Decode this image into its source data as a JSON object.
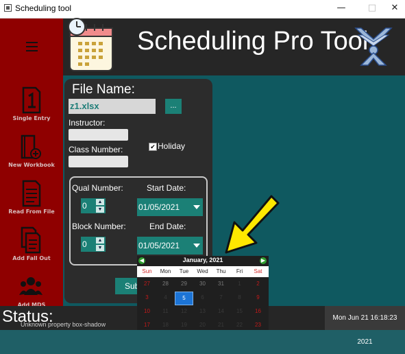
{
  "window": {
    "title": "Scheduling tool",
    "controls": [
      "—",
      "□",
      "✕"
    ]
  },
  "header": {
    "title": "Scheduling Pro Tool"
  },
  "sidebar": {
    "items": [
      {
        "label": "Single Entry",
        "icon": "number-one-document-icon"
      },
      {
        "label": "New Workbook",
        "icon": "add-book-icon"
      },
      {
        "label": "Read From File",
        "icon": "document-lines-icon"
      },
      {
        "label": "Add Fall Out",
        "icon": "copy-documents-icon"
      },
      {
        "label": "Add MDS",
        "icon": "people-group-icon"
      }
    ]
  },
  "form": {
    "file_label": "File Name:",
    "file_value": "z1.xlsx",
    "browse_label": "...",
    "instructor_label": "Instructor:",
    "instructor_value": "",
    "class_label": "Class Number:",
    "class_value": "",
    "holiday_label": "Holiday",
    "holiday_checked": true,
    "holiday_mark": "✔",
    "qual_label": "Qual Number:",
    "qual_value": "0",
    "block_label": "Block Number:",
    "block_value": "0",
    "start_label": "Start Date:",
    "start_value": "01/05/2021",
    "end_label": "End Date:",
    "end_value": "01/05/2021",
    "submit_label": "Submit"
  },
  "calendar": {
    "month": "January, 2021",
    "weekdays": [
      "Sun",
      "Mon",
      "Tue",
      "Wed",
      "Thu",
      "Fri",
      "Sat"
    ],
    "weeks": [
      [
        "27",
        "28",
        "29",
        "30",
        "31",
        "1",
        "2"
      ],
      [
        "3",
        "4",
        "5",
        "6",
        "7",
        "8",
        "9"
      ],
      [
        "10",
        "11",
        "12",
        "13",
        "14",
        "15",
        "16"
      ],
      [
        "17",
        "18",
        "19",
        "20",
        "21",
        "22",
        "23"
      ]
    ],
    "selected_day": "5"
  },
  "status": {
    "label": "Status:",
    "clock": "Mon Jun 21 16:18:23 2021",
    "message": "Unknown property box-shadow"
  },
  "colors": {
    "sidebar": "#8f0000",
    "header": "#262626",
    "accent": "#1b8076",
    "background": "#0f5960",
    "arrow": "#ffe800"
  }
}
